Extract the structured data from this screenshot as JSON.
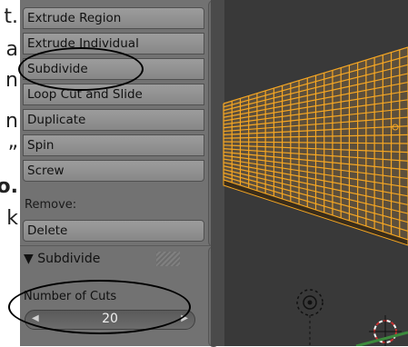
{
  "document": {
    "fragments": [
      "t.",
      "a",
      "n",
      "n",
      "”",
      "o.",
      "k"
    ]
  },
  "tools": {
    "items": [
      "Extrude Region",
      "Extrude Individual",
      "Subdivide",
      "Loop Cut and Slide",
      "Duplicate",
      "Spin",
      "Screw"
    ],
    "remove_label": "Remove:",
    "delete_label": "Delete"
  },
  "operator": {
    "title": "▼ Subdivide",
    "cuts_label": "Number of Cuts",
    "cuts_value": "20",
    "left_arrow": "◀",
    "right_arrow": "▶"
  },
  "colors": {
    "panel_bg": "#727272",
    "viewport_bg": "#393939",
    "mesh_orange": "#f5a623"
  }
}
